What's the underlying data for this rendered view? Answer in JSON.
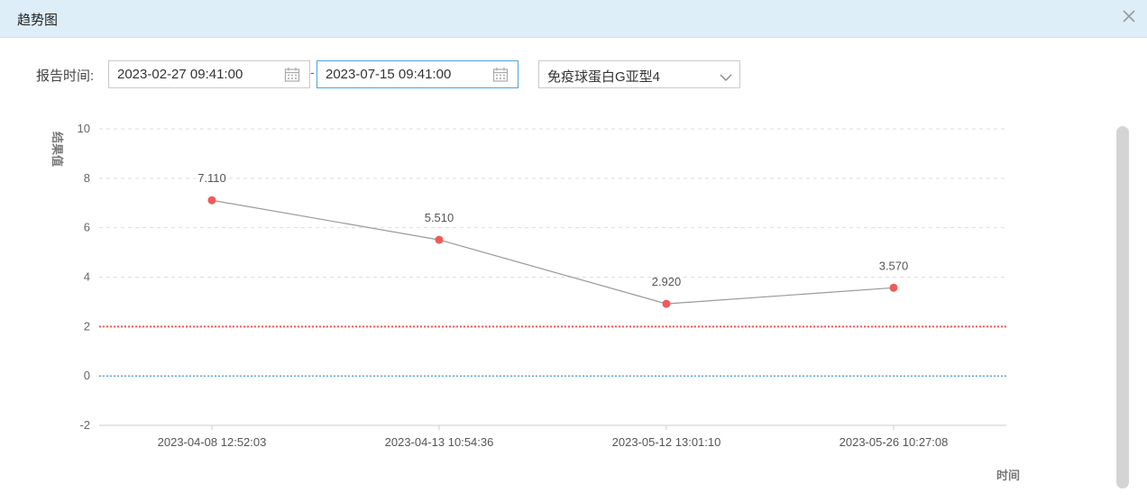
{
  "dialog": {
    "title": "趋势图",
    "close_icon": "close-icon"
  },
  "filters": {
    "report_time_label": "报告时间:",
    "start_date": "2023-02-27 09:41:00",
    "end_date": "2023-07-15 09:41:00",
    "separator": "-",
    "calendar_icon": "calendar-icon",
    "test_item": "免疫球蛋白G亚型4",
    "dropdown_icon": "chevron-down-icon"
  },
  "chart_data": {
    "type": "line",
    "ylabel": "结果值",
    "xlabel": "时间",
    "ylim": [
      -2,
      10
    ],
    "yticks": [
      -2,
      0,
      2,
      4,
      6,
      8,
      10
    ],
    "x": [
      "2023-04-08 12:52:03",
      "2023-04-13 10:54:36",
      "2023-05-12 13:01:10",
      "2023-05-26 10:27:08"
    ],
    "series": [
      {
        "values": [
          7.11,
          5.51,
          2.92,
          3.57
        ],
        "labels": [
          "7.110",
          "5.510",
          "2.920",
          "3.570"
        ],
        "color": "#999999",
        "point_color": "#f05a5a"
      }
    ],
    "reference_lines": [
      {
        "value": 2,
        "color": "#f05a5a",
        "style": "dotted"
      },
      {
        "value": 0,
        "color": "#2d8fd1",
        "style": "dotted"
      }
    ],
    "grid": true,
    "legend": "none"
  }
}
